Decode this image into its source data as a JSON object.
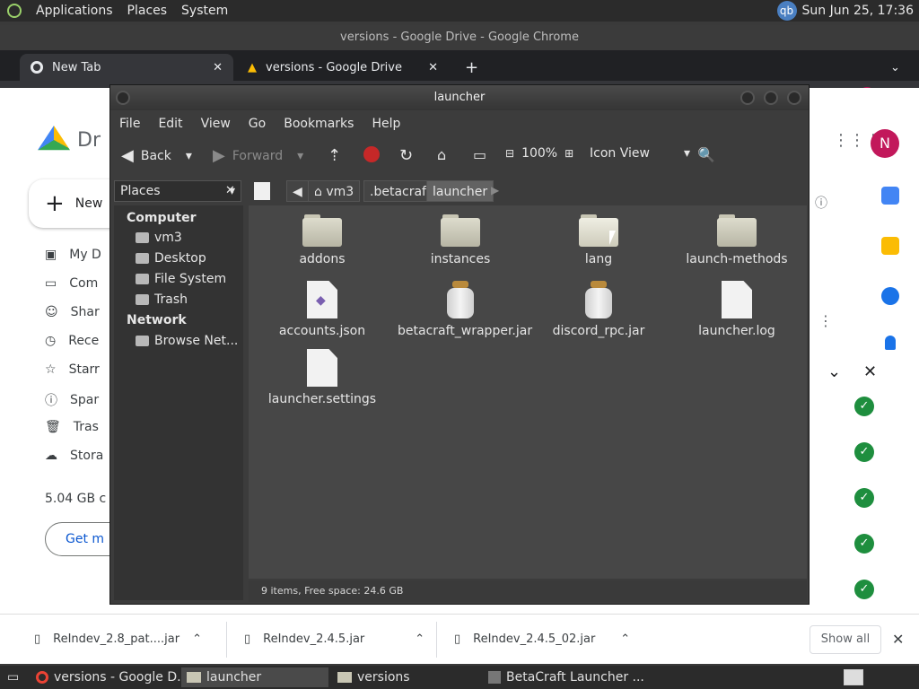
{
  "top_panel": {
    "menus": [
      "Applications",
      "Places",
      "System"
    ],
    "user_badge": "qb",
    "clock": "Sun Jun 25, 17:36"
  },
  "chrome": {
    "window_title": "versions - Google Drive - Google Chrome",
    "tabs": [
      {
        "label": "New Tab"
      },
      {
        "label": "versions - Google Drive"
      }
    ],
    "avatar": "N"
  },
  "drive": {
    "logo_partial": "Dr",
    "new_button": "New",
    "sidebar": [
      {
        "label": "My D",
        "icon": "my-drive-icon"
      },
      {
        "label": "Com",
        "icon": "computers-icon"
      },
      {
        "label": "Shar",
        "icon": "shared-icon"
      },
      {
        "label": "Rece",
        "icon": "recent-icon"
      },
      {
        "label": "Starr",
        "icon": "star-icon"
      },
      {
        "label": "Spar",
        "icon": "spam-icon"
      },
      {
        "label": "Tras",
        "icon": "trash-icon"
      },
      {
        "label": "Stora",
        "icon": "cloud-icon"
      }
    ],
    "storage_used": "5.04 GB c",
    "get_more": "Get m",
    "avatar": "N"
  },
  "downloads": {
    "items": [
      {
        "name": "ReIndev_2.8_pat....jar"
      },
      {
        "name": "ReIndev_2.4.5.jar"
      },
      {
        "name": "ReIndev_2.4.5_02.jar"
      }
    ],
    "show_all": "Show all"
  },
  "taskbar": {
    "tasks": [
      {
        "label": "versions - Google D..."
      },
      {
        "label": "launcher"
      },
      {
        "label": "versions"
      },
      {
        "label": "BetaCraft Launcher ..."
      }
    ]
  },
  "file_manager": {
    "title": "launcher",
    "menu": [
      "File",
      "Edit",
      "View",
      "Go",
      "Bookmarks",
      "Help"
    ],
    "toolbar": {
      "back": "Back",
      "forward": "Forward",
      "zoom": "100%",
      "view_mode": "Icon View"
    },
    "places_label": "Places",
    "breadcrumbs": [
      "vm3",
      ".betacraft",
      "launcher"
    ],
    "sidebar": {
      "computer_heading": "Computer",
      "computer_items": [
        "vm3",
        "Desktop",
        "File System",
        "Trash"
      ],
      "network_heading": "Network",
      "network_items": [
        "Browse Net..."
      ]
    },
    "files": [
      {
        "name": "addons",
        "type": "folder"
      },
      {
        "name": "instances",
        "type": "folder"
      },
      {
        "name": "lang",
        "type": "folder"
      },
      {
        "name": "launch-methods",
        "type": "folder"
      },
      {
        "name": "accounts.json",
        "type": "json"
      },
      {
        "name": "betacraft_wrapper.jar",
        "type": "jar"
      },
      {
        "name": "discord_rpc.jar",
        "type": "jar"
      },
      {
        "name": "launcher.log",
        "type": "text"
      },
      {
        "name": "launcher.settings",
        "type": "text"
      }
    ],
    "status": "9 items, Free space: 24.6 GB"
  }
}
